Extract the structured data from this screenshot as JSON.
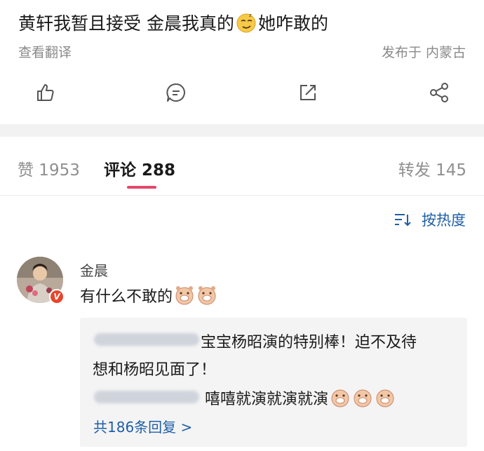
{
  "post": {
    "text_before_emoji": "黄轩我暂且接受 金晨我真的",
    "emoji": "smirk-face-emoji",
    "text_after_emoji": "她咋敢的",
    "translate_label": "查看翻译",
    "location": "发布于 内蒙古"
  },
  "actions": {
    "like": "like-icon",
    "comment": "comment-icon",
    "share": "repost-icon",
    "more": "share-icon"
  },
  "tabs": {
    "likes": "赞 1953",
    "comments": "评论 288",
    "reposts": "转发 145"
  },
  "sort": {
    "label": "按热度"
  },
  "comment": {
    "author": "金晨",
    "text": "有什么不敢的",
    "emojis": [
      "pig-face-emoji",
      "pig-face-emoji"
    ],
    "verified_badge": "V",
    "replies": [
      {
        "text_line1": "宝宝杨昭演的特别棒！迫不及待",
        "text_line2": "想和杨昭见面了！"
      },
      {
        "text_line1": "嘻嘻就演就演就演"
      }
    ],
    "more_replies": "共186条回复 >"
  },
  "colors": {
    "accent": "#e5476a",
    "link": "#1f5fa6",
    "muted": "#8a8a8a",
    "badge": "#e8452c"
  }
}
